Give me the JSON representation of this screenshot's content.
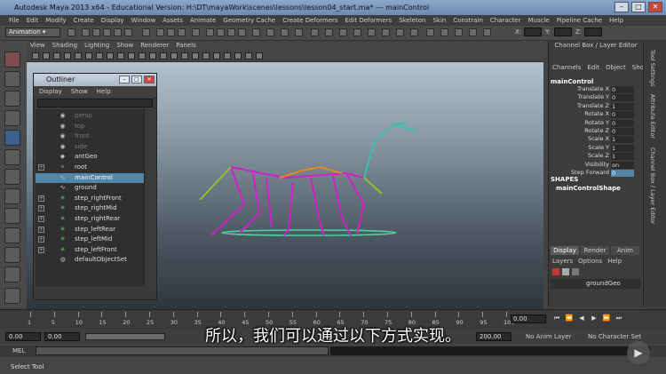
{
  "window": {
    "title": "Autodesk Maya 2013 x64 - Educational Version: H:\\DT\\mayaWork\\scenes\\lessons\\lesson04_start.ma*  ---  mainControl"
  },
  "menubar": [
    "File",
    "Edit",
    "Modify",
    "Create",
    "Display",
    "Window",
    "Assets",
    "Animate",
    "Geometry Cache",
    "Create Deformers",
    "Edit Deformers",
    "Skeleton",
    "Skin",
    "Constrain",
    "Character",
    "Muscle",
    "Pipeline Cache",
    "Help"
  ],
  "status_line": {
    "mode": "Animation",
    "x_label": "X:",
    "y_label": "Y:",
    "z_label": "Z:"
  },
  "viewport_menu": [
    "View",
    "Shading",
    "Lighting",
    "Show",
    "Renderer",
    "Panels"
  ],
  "outliner": {
    "title": "Outliner",
    "menu": [
      "Display",
      "Show",
      "Help"
    ],
    "rows": [
      {
        "label": "persp",
        "icon": "camera-icon",
        "dim": true,
        "expand": false
      },
      {
        "label": "top",
        "icon": "camera-icon",
        "dim": true,
        "expand": false
      },
      {
        "label": "front",
        "icon": "camera-icon",
        "dim": true,
        "expand": false
      },
      {
        "label": "side",
        "icon": "camera-icon",
        "dim": true,
        "expand": false
      },
      {
        "label": "antGeo",
        "icon": "mesh-icon",
        "dim": false,
        "expand": false
      },
      {
        "label": "root",
        "icon": "joint-icon",
        "dim": false,
        "expand": true
      },
      {
        "label": "mainControl",
        "icon": "curve-icon",
        "dim": false,
        "expand": false,
        "selected": true
      },
      {
        "label": "ground",
        "icon": "curve-icon",
        "dim": false,
        "expand": false
      },
      {
        "label": "step_rightFront",
        "icon": "ik-handle-icon",
        "dim": false,
        "expand": true
      },
      {
        "label": "step_rightMid",
        "icon": "ik-handle-icon",
        "dim": false,
        "expand": true
      },
      {
        "label": "step_rightRear",
        "icon": "ik-handle-icon",
        "dim": false,
        "expand": true
      },
      {
        "label": "step_leftRear",
        "icon": "ik-handle-icon",
        "dim": false,
        "expand": true
      },
      {
        "label": "step_leftMid",
        "icon": "ik-handle-icon",
        "dim": false,
        "expand": true
      },
      {
        "label": "step_leftFront",
        "icon": "ik-handle-icon",
        "dim": false,
        "expand": true
      },
      {
        "label": "defaultObjectSet",
        "icon": "set-icon",
        "dim": false,
        "expand": false
      }
    ]
  },
  "channel_box": {
    "title": "Channel Box / Layer Editor",
    "menu": [
      "Channels",
      "Edit",
      "Object",
      "Show"
    ],
    "object": "mainControl",
    "attributes": [
      {
        "name": "Translate X",
        "value": "0"
      },
      {
        "name": "Translate Y",
        "value": "0"
      },
      {
        "name": "Translate Z",
        "value": "1"
      },
      {
        "name": "Rotate X",
        "value": "0"
      },
      {
        "name": "Rotate Y",
        "value": "0"
      },
      {
        "name": "Rotate Z",
        "value": "0"
      },
      {
        "name": "Scale X",
        "value": "1"
      },
      {
        "name": "Scale Y",
        "value": "1"
      },
      {
        "name": "Scale Z",
        "value": "1"
      },
      {
        "name": "Visibility",
        "value": "on"
      },
      {
        "name": "Step Forward",
        "value": "0",
        "highlight": true
      }
    ],
    "shapes_header": "SHAPES",
    "shape_name": "mainControlShape",
    "tabs": [
      "Display",
      "Render",
      "Anim"
    ],
    "layer_menu": [
      "Layers",
      "Options",
      "Help"
    ],
    "layer_row": "groundGeo"
  },
  "right_tabs": [
    "Tool Settings",
    "Attribute Editor",
    "Channel Box / Layer Editor"
  ],
  "timeline": {
    "ticks": [
      "1",
      "5",
      "10",
      "15",
      "20",
      "25",
      "30",
      "35",
      "40",
      "45",
      "50",
      "55",
      "60",
      "65",
      "70",
      "75",
      "80",
      "85",
      "90",
      "95",
      "100"
    ],
    "current_frame": "0.00"
  },
  "range_slider": {
    "start": "0.00",
    "inner_start": "0.00",
    "end_value": "200.00",
    "anim_layer": "No Anim Layer",
    "character_set": "No Character Set"
  },
  "command_line": {
    "label": "MEL"
  },
  "help_line": "Select Tool",
  "subtitle": "所以，我们可以通过以下方式实现。"
}
